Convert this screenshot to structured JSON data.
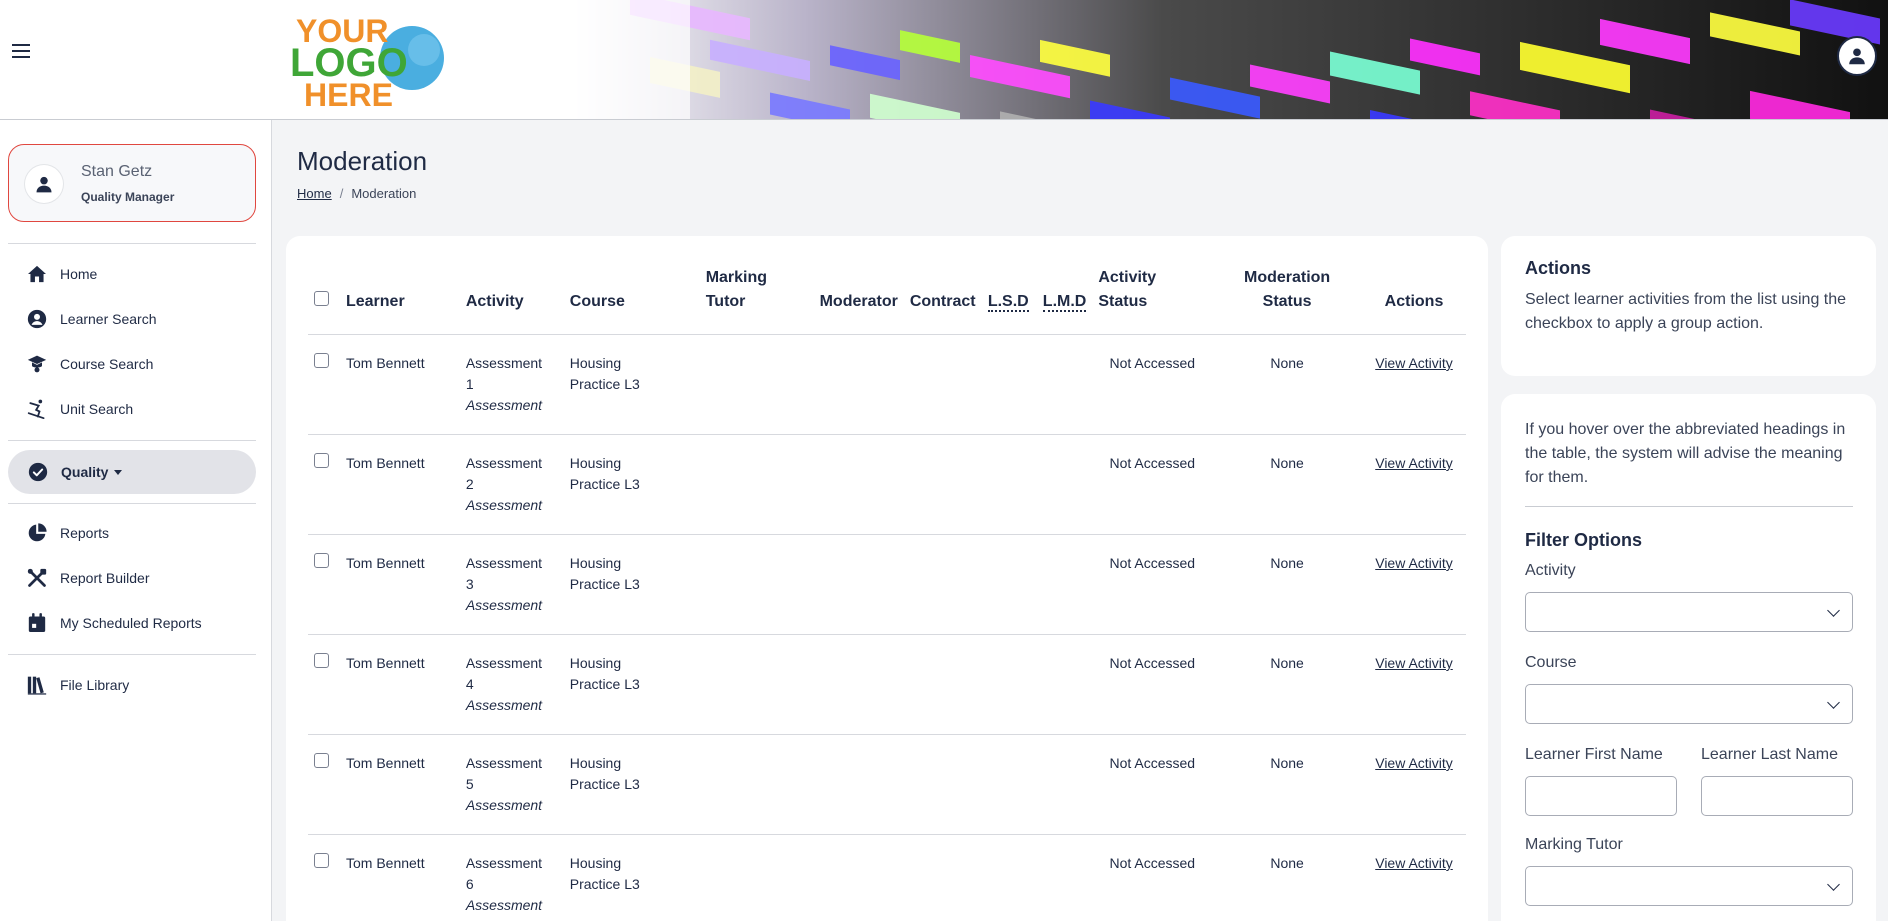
{
  "header": {
    "menu_icon": "hamburger-icon",
    "logo_text_line1": "YOUR",
    "logo_text_line2": "LOGO",
    "logo_text_line3": "HERE",
    "account_icon": "user-icon"
  },
  "sidebar": {
    "user": {
      "name": "Stan Getz",
      "role": "Quality Manager"
    },
    "items": [
      {
        "label": "Home",
        "icon": "home-icon"
      },
      {
        "label": "Learner Search",
        "icon": "user-circle-icon"
      },
      {
        "label": "Course Search",
        "icon": "graduation-icon"
      },
      {
        "label": "Unit Search",
        "icon": "skier-icon"
      },
      {
        "label": "Quality",
        "icon": "check-circle-icon"
      },
      {
        "label": "Reports",
        "icon": "pie-chart-icon"
      },
      {
        "label": "Report Builder",
        "icon": "tools-icon"
      },
      {
        "label": "My Scheduled Reports",
        "icon": "calendar-icon"
      },
      {
        "label": "File Library",
        "icon": "books-icon"
      }
    ]
  },
  "page": {
    "title": "Moderation",
    "breadcrumb": {
      "home": "Home",
      "current": "Moderation",
      "separator": "/"
    }
  },
  "table": {
    "headers": {
      "learner": "Learner",
      "activity": "Activity",
      "course": "Course",
      "marking_tutor": "Marking Tutor",
      "moderator": "Moderator",
      "contract": "Contract",
      "lsd": "L.S.D",
      "lmd": "L.M.D",
      "activity_status": "Activity Status",
      "moderation_status": "Moderation Status",
      "actions": "Actions"
    },
    "rows": [
      {
        "learner": "Tom Bennett",
        "activity_line1": "Assessment",
        "activity_line2": "1",
        "activity_type": "Assessment",
        "course": "Housing Practice L3",
        "marking_tutor": "",
        "moderator": "",
        "contract": "",
        "lsd": "",
        "lmd": "",
        "activity_status": "Not Accessed",
        "moderation_status": "None",
        "action": "View Activity"
      },
      {
        "learner": "Tom Bennett",
        "activity_line1": "Assessment",
        "activity_line2": "2",
        "activity_type": "Assessment",
        "course": "Housing Practice L3",
        "marking_tutor": "",
        "moderator": "",
        "contract": "",
        "lsd": "",
        "lmd": "",
        "activity_status": "Not Accessed",
        "moderation_status": "None",
        "action": "View Activity"
      },
      {
        "learner": "Tom Bennett",
        "activity_line1": "Assessment",
        "activity_line2": "3",
        "activity_type": "Assessment",
        "course": "Housing Practice L3",
        "marking_tutor": "",
        "moderator": "",
        "contract": "",
        "lsd": "",
        "lmd": "",
        "activity_status": "Not Accessed",
        "moderation_status": "None",
        "action": "View Activity"
      },
      {
        "learner": "Tom Bennett",
        "activity_line1": "Assessment",
        "activity_line2": "4",
        "activity_type": "Assessment",
        "course": "Housing Practice L3",
        "marking_tutor": "",
        "moderator": "",
        "contract": "",
        "lsd": "",
        "lmd": "",
        "activity_status": "Not Accessed",
        "moderation_status": "None",
        "action": "View Activity"
      },
      {
        "learner": "Tom Bennett",
        "activity_line1": "Assessment",
        "activity_line2": "5",
        "activity_type": "Assessment",
        "course": "Housing Practice L3",
        "marking_tutor": "",
        "moderator": "",
        "contract": "",
        "lsd": "",
        "lmd": "",
        "activity_status": "Not Accessed",
        "moderation_status": "None",
        "action": "View Activity"
      },
      {
        "learner": "Tom Bennett",
        "activity_line1": "Assessment",
        "activity_line2": "6",
        "activity_type": "Assessment",
        "course": "Housing Practice L3",
        "marking_tutor": "",
        "moderator": "",
        "contract": "",
        "lsd": "",
        "lmd": "",
        "activity_status": "Not Accessed",
        "moderation_status": "None",
        "action": "View Activity"
      }
    ]
  },
  "actions_panel": {
    "title": "Actions",
    "text": "Select learner activities from the list using the checkbox to apply a group action."
  },
  "filter_panel": {
    "hint": "If you hover over the abbreviated headings in the table, the system will advise the meaning for them.",
    "title": "Filter Options",
    "activity_label": "Activity",
    "activity_value": "",
    "course_label": "Course",
    "course_value": "",
    "first_name_label": "Learner First Name",
    "first_name_value": "",
    "last_name_label": "Learner Last Name",
    "last_name_value": "",
    "marking_tutor_label": "Marking Tutor",
    "marking_tutor_value": ""
  },
  "colors": {
    "primary": "#1f2a44",
    "profile_border": "#e0473f",
    "active_nav_bg": "#e2e3e8",
    "page_bg": "#f3f4f6",
    "logo_orange": "#f0902a",
    "logo_green": "#3fa637",
    "logo_blue": "#4aaee0"
  }
}
